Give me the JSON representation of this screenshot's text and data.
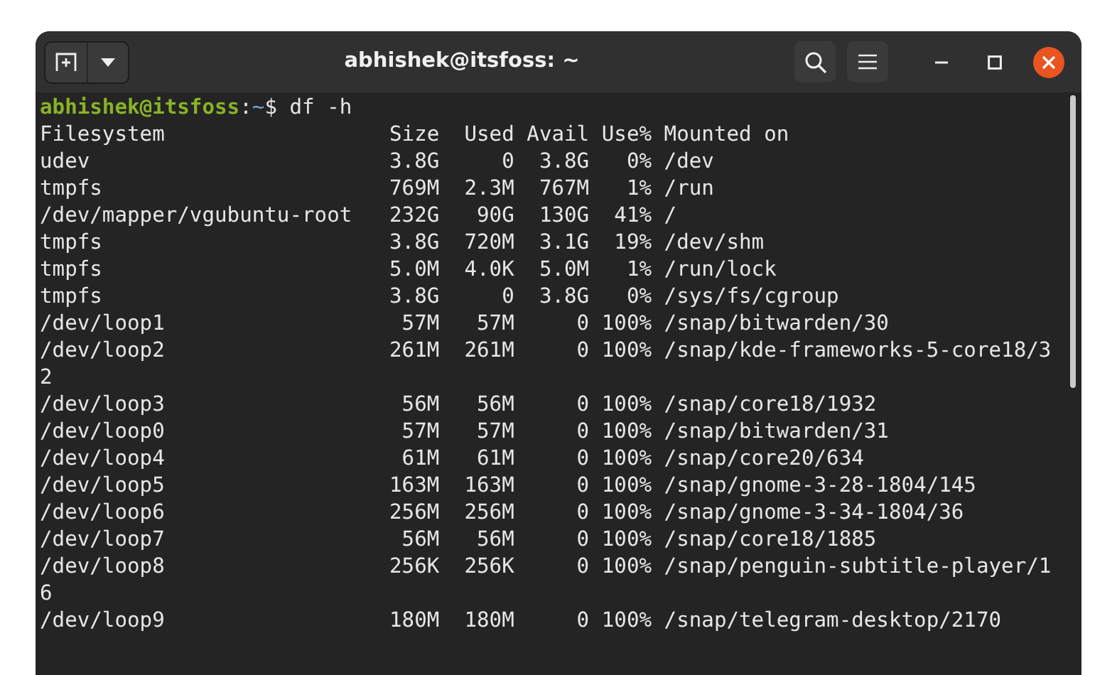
{
  "window": {
    "title": "abhishek@itsfoss: ~"
  },
  "prompt": {
    "user": "abhishek@itsfoss",
    "separator": ":",
    "path": "~",
    "command": "$ df -h"
  },
  "output_lines": [
    "Filesystem                  Size  Used Avail Use% Mounted on",
    "udev                        3.8G     0  3.8G   0% /dev",
    "tmpfs                       769M  2.3M  767M   1% /run",
    "/dev/mapper/vgubuntu-root   232G   90G  130G  41% /",
    "tmpfs                       3.8G  720M  3.1G  19% /dev/shm",
    "tmpfs                       5.0M  4.0K  5.0M   1% /run/lock",
    "tmpfs                       3.8G     0  3.8G   0% /sys/fs/cgroup",
    "/dev/loop1                   57M   57M     0 100% /snap/bitwarden/30",
    "/dev/loop2                  261M  261M     0 100% /snap/kde-frameworks-5-core18/3",
    "2",
    "/dev/loop3                   56M   56M     0 100% /snap/core18/1932",
    "/dev/loop0                   57M   57M     0 100% /snap/bitwarden/31",
    "/dev/loop4                   61M   61M     0 100% /snap/core20/634",
    "/dev/loop5                  163M  163M     0 100% /snap/gnome-3-28-1804/145",
    "/dev/loop6                  256M  256M     0 100% /snap/gnome-3-34-1804/36",
    "/dev/loop7                   56M   56M     0 100% /snap/core18/1885",
    "/dev/loop8                  256K  256K     0 100% /snap/penguin-subtitle-player/1",
    "6",
    "/dev/loop9                  180M  180M     0 100% /snap/telegram-desktop/2170"
  ]
}
